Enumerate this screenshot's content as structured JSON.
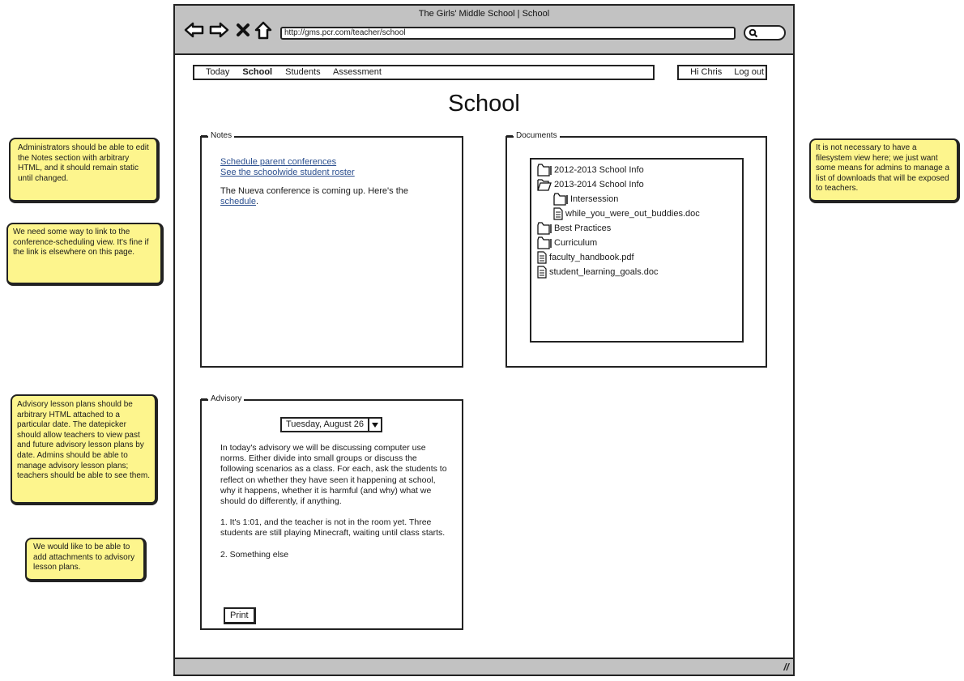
{
  "browser": {
    "window_title": "The Girls' Middle School | School",
    "url": "http://gms.pcr.com/teacher/school",
    "icons": [
      "back-arrow-icon",
      "forward-arrow-icon",
      "stop-icon",
      "home-icon",
      "search-icon"
    ]
  },
  "topnav": {
    "items": [
      {
        "label": "Today",
        "active": false
      },
      {
        "label": "School",
        "active": true
      },
      {
        "label": "Students",
        "active": false
      },
      {
        "label": "Assessment",
        "active": false
      }
    ],
    "greeting": "Hi Chris",
    "logout": "Log out"
  },
  "page": {
    "title": "School"
  },
  "notes": {
    "label": "Notes",
    "links": [
      "Schedule parent conferences",
      "See the schoolwide student roster"
    ],
    "paragraph_text": "The Nueva conference is coming up. Here's the ",
    "paragraph_link": "schedule",
    "paragraph_end": "."
  },
  "documents": {
    "label": "Documents",
    "items": [
      {
        "name": "2012-2013 School Info",
        "type": "folder",
        "level": 0
      },
      {
        "name": "2013-2014 School Info",
        "type": "folder-open",
        "level": 0
      },
      {
        "name": "Intersession",
        "type": "folder",
        "level": 1
      },
      {
        "name": "while_you_were_out_buddies.doc",
        "type": "file",
        "level": 1
      },
      {
        "name": "Best Practices",
        "type": "folder",
        "level": 0
      },
      {
        "name": "Curriculum",
        "type": "folder",
        "level": 0
      },
      {
        "name": "faculty_handbook.pdf",
        "type": "file",
        "level": 0
      },
      {
        "name": "student_learning_goals.doc",
        "type": "file",
        "level": 0
      }
    ]
  },
  "advisory": {
    "label": "Advisory",
    "date": "Tuesday, August 26",
    "paragraphs": [
      "In today's advisory we will be discussing computer use norms. Either divide into small groups or discuss the following scenarios as a class. For each, ask the students to reflect on whether they have seen it happening at school, why it happens, whether it is harmful (and why) what we should do differently, if anything.",
      "1. It's 1:01, and the teacher is not in the room yet. Three students are still playing Minecraft, waiting until class starts.",
      "2. Something else"
    ],
    "print_label": "Print"
  },
  "annotations": [
    "Administrators should be able to edit the Notes section with arbitrary HTML, and it should remain static until changed.",
    "We need some way to link to the conference-scheduling view. It's fine if the link is elsewhere on this page.",
    "Advisory lesson plans should be arbitrary HTML attached to a particular date. The datepicker should allow teachers to view past and future advisory lesson plans by date. Admins should be able to manage advisory lesson plans; teachers should be able to see them.",
    "We would like to be able to add attachments to advisory lesson plans.",
    "It is not necessary to have a filesystem view here; we just want some means for admins to manage a list of downloads that will be exposed to teachers."
  ],
  "colors": {
    "chrome_gray": "#c2c2c2",
    "sticky_yellow": "#fdf58d",
    "link_blue": "#2b4f8f"
  }
}
